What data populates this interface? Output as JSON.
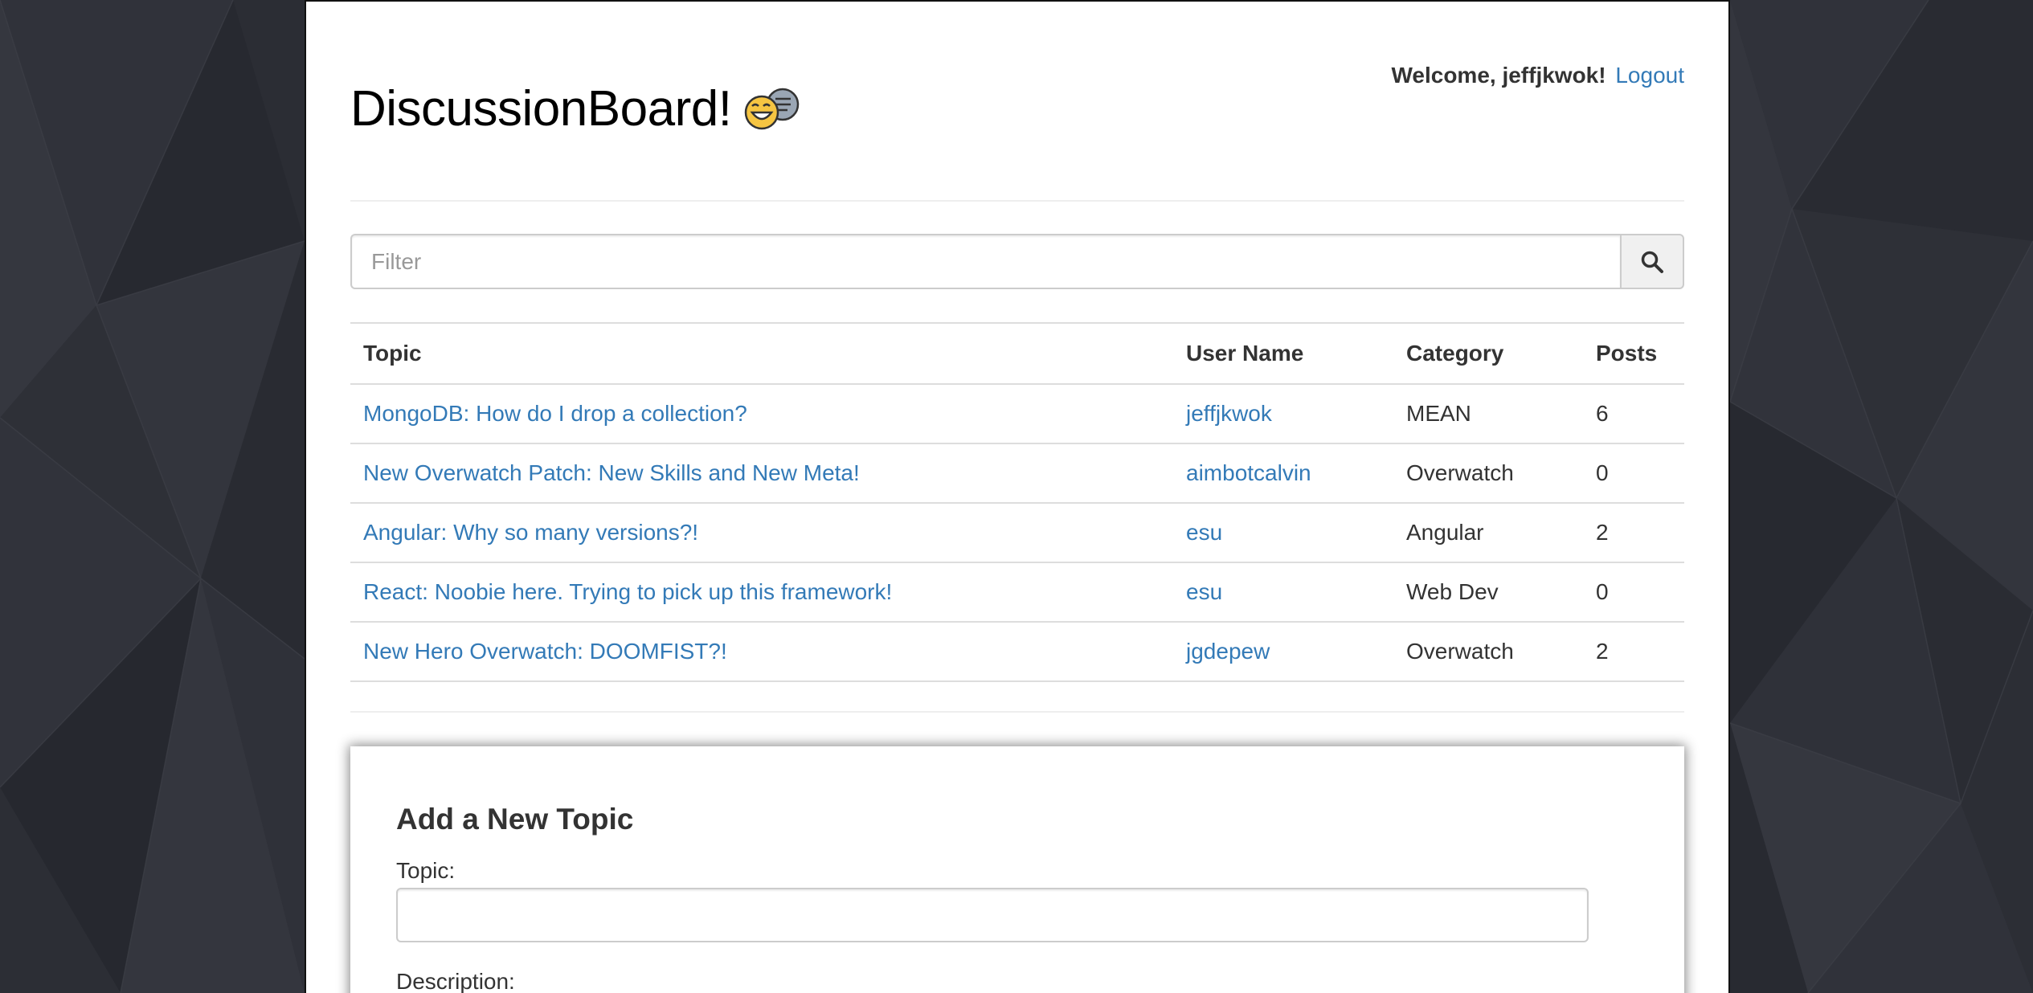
{
  "header": {
    "title": "DiscussionBoard!",
    "welcome_text": "Welcome, jeffjkwok!",
    "logout_label": "Logout"
  },
  "search": {
    "placeholder": "Filter",
    "value": ""
  },
  "table": {
    "headers": [
      "Topic",
      "User Name",
      "Category",
      "Posts"
    ],
    "rows": [
      {
        "topic": "MongoDB: How do I drop a collection?",
        "user": "jeffjkwok",
        "category": "MEAN",
        "posts": "6"
      },
      {
        "topic": "New Overwatch Patch: New Skills and New Meta!",
        "user": "aimbotcalvin",
        "category": "Overwatch",
        "posts": "0"
      },
      {
        "topic": "Angular: Why so many versions?!",
        "user": "esu",
        "category": "Angular",
        "posts": "2"
      },
      {
        "topic": "React: Noobie here. Trying to pick up this framework!",
        "user": "esu",
        "category": "Web Dev",
        "posts": "0"
      },
      {
        "topic": "New Hero Overwatch: DOOMFIST?!",
        "user": "jgdepew",
        "category": "Overwatch",
        "posts": "2"
      }
    ]
  },
  "new_topic": {
    "heading": "Add a New Topic",
    "topic_label": "Topic:",
    "topic_value": "",
    "description_label": "Description:"
  },
  "colors": {
    "link": "#337ab7",
    "background": "#2b2d34",
    "text": "#333333"
  },
  "icons": {
    "logo": "laughing-chat-bubble-icon",
    "search": "search-icon"
  }
}
